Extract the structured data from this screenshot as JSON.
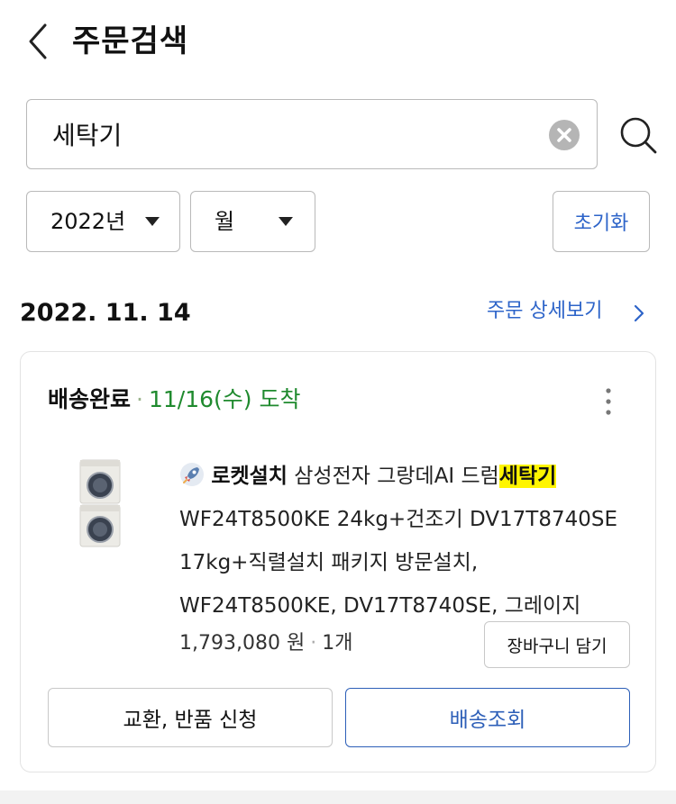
{
  "header": {
    "title": "주문검색"
  },
  "search": {
    "value": "세탁기"
  },
  "filters": {
    "year": "2022년",
    "month": "월",
    "reset_label": "초기화"
  },
  "order": {
    "date": "2022. 11. 14",
    "detail_link": "주문 상세보기",
    "status": "배송완료",
    "arrival": "11/16(수) 도착",
    "product": {
      "badge": "로켓설치",
      "name_prefix": "삼성전자 그랑데AI 드럼",
      "name_highlight": "세탁기",
      "line2": "WF24T8500KE 24kg+건조기 DV17T8740SE",
      "line3": "17kg+직렬설치 패키지 방문설치,",
      "line4": "WF24T8500KE, DV17T8740SE, 그레이지"
    },
    "price": "1,793,080 원",
    "quantity": "1개",
    "cart_button": "장바구니 담기",
    "exchange_button": "교환, 반품 신청",
    "track_button": "배송조회"
  },
  "colors": {
    "accent_blue": "#2d64c9",
    "arrival_green": "#1f8a2e",
    "highlight_yellow": "#fff500"
  }
}
